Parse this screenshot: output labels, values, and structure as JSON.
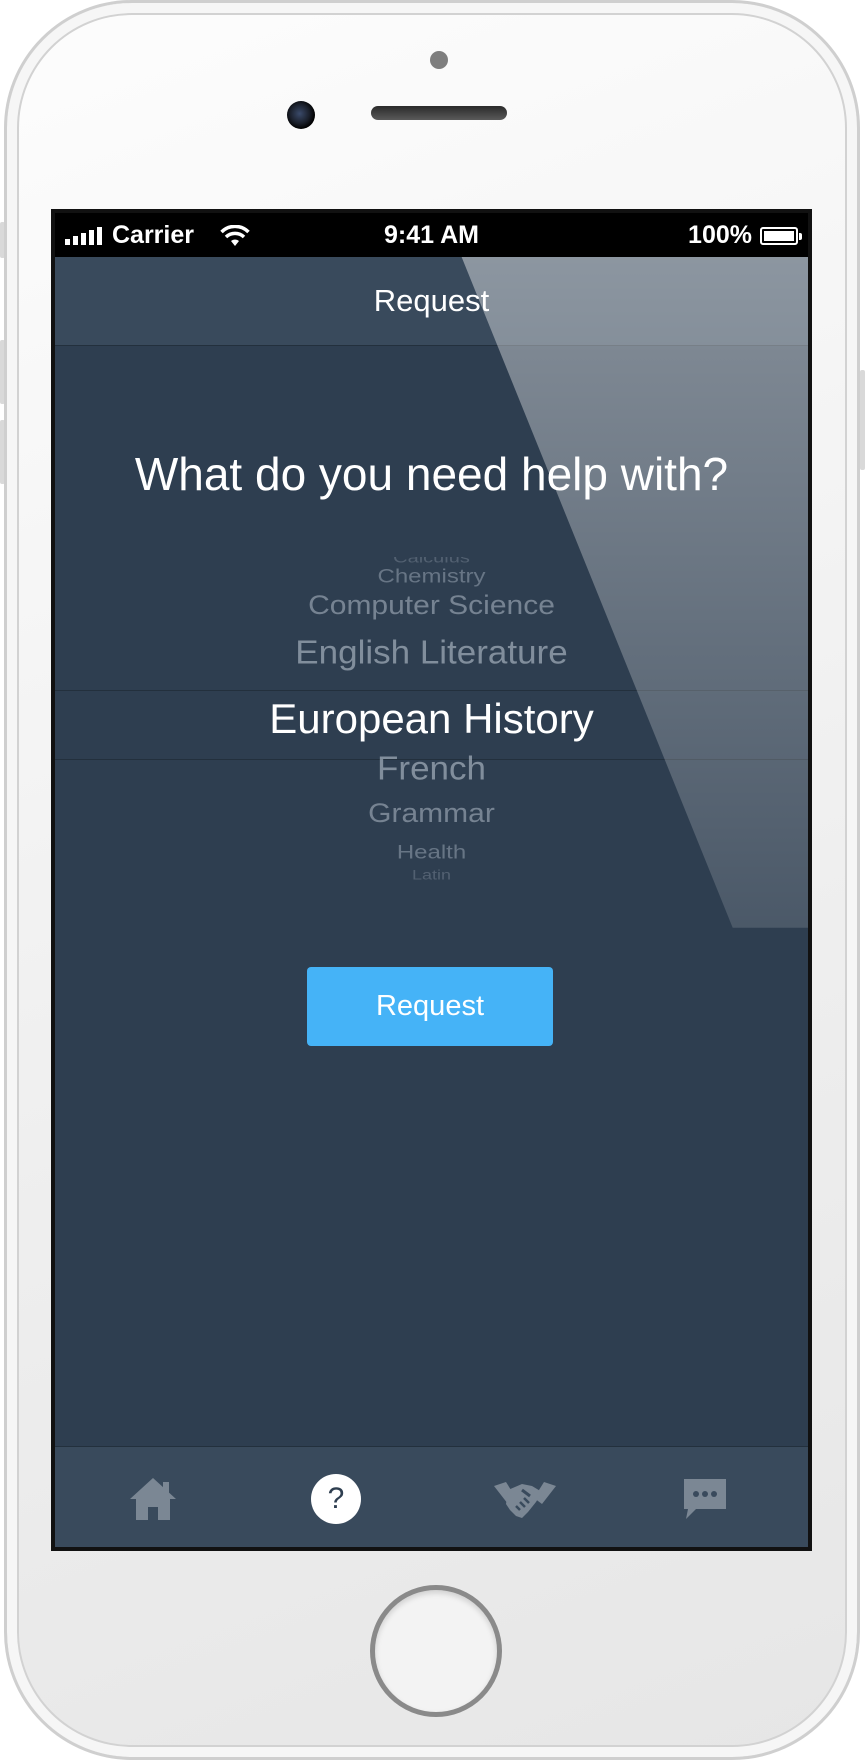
{
  "status_bar": {
    "carrier": "Carrier",
    "time": "9:41 AM",
    "battery": "100%"
  },
  "nav": {
    "title": "Request"
  },
  "prompt": {
    "question": "What do you need help with?"
  },
  "picker": {
    "items": [
      "Calculus",
      "Chemistry",
      "Computer Science",
      "English Literature",
      "European History",
      "French",
      "Grammar",
      "Health",
      "Latin"
    ],
    "selected": "European History"
  },
  "actions": {
    "request_label": "Request"
  },
  "tabbar": {
    "tabs": [
      {
        "icon": "home-icon"
      },
      {
        "icon": "help-icon",
        "label": "?"
      },
      {
        "icon": "handshake-icon"
      },
      {
        "icon": "chat-icon"
      }
    ],
    "selected_index": 1
  },
  "colors": {
    "background": "#2e3e50",
    "bars": "#394a5c",
    "accent": "#45b3f7"
  }
}
